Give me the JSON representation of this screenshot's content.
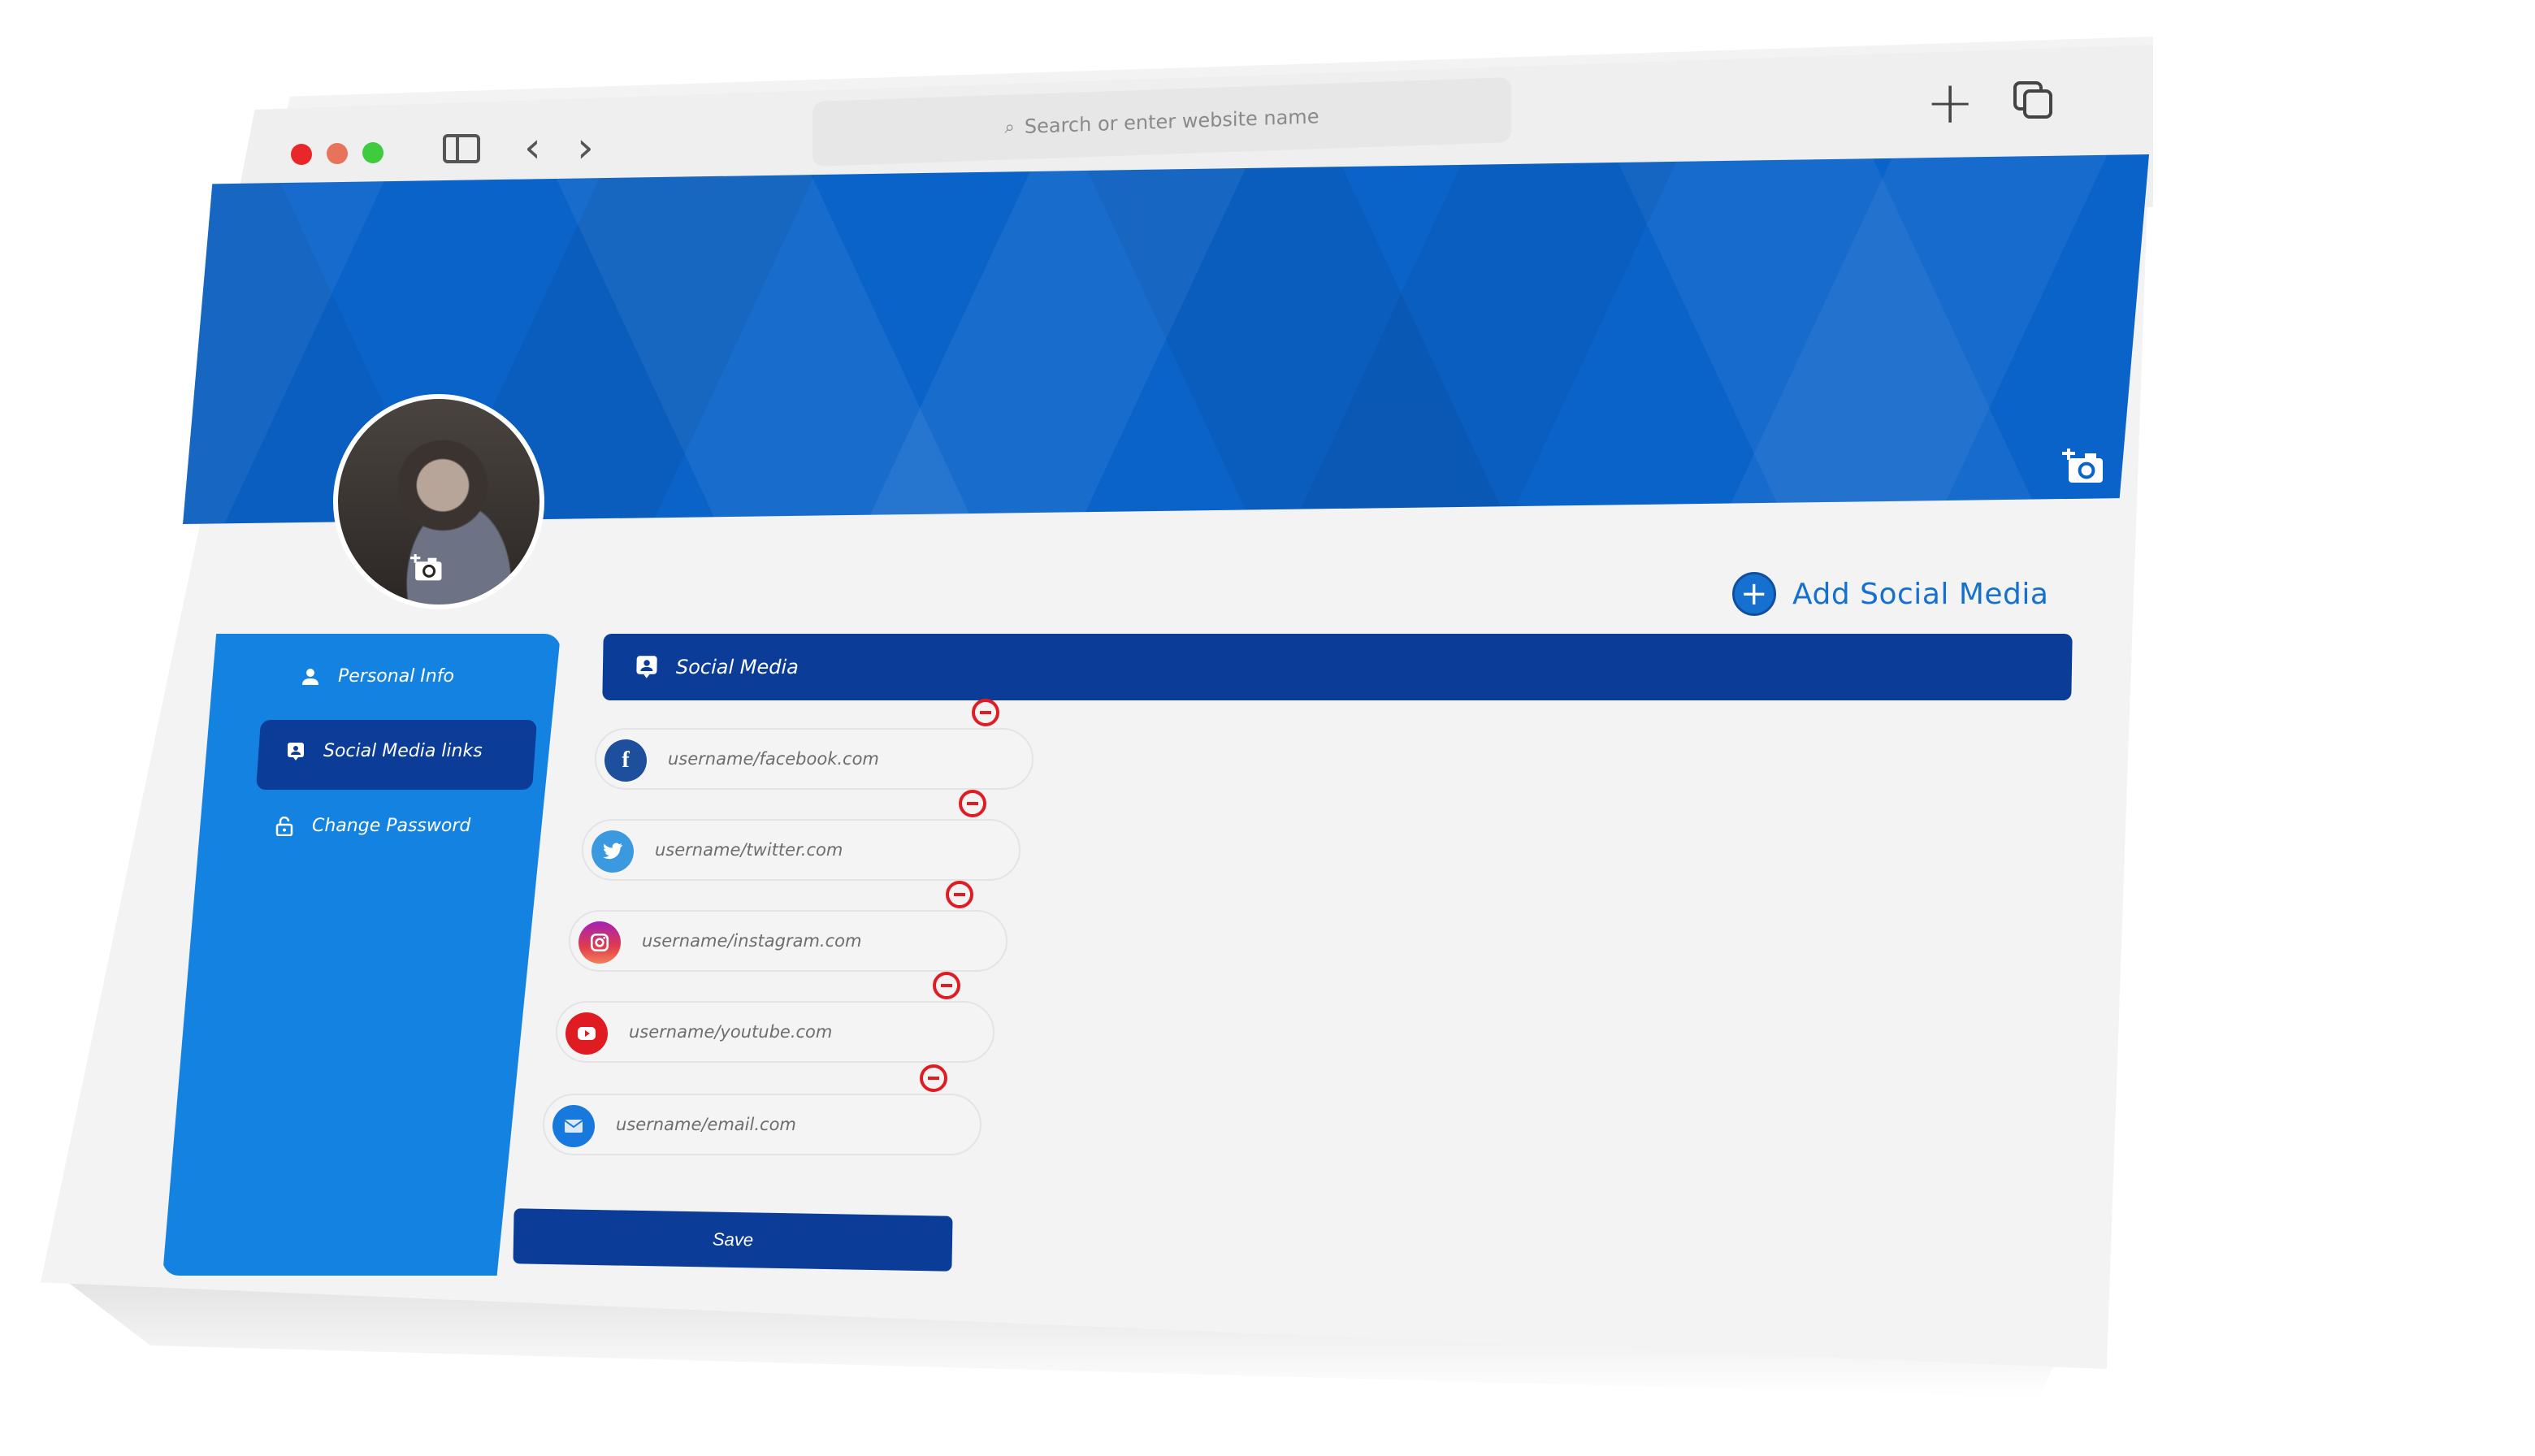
{
  "browser": {
    "address_placeholder": "Search or enter website name",
    "traffic_lights": [
      "close",
      "minimize",
      "maximize"
    ],
    "icons": {
      "sidebar": "sidebar-icon",
      "back": "‹",
      "forward": "›",
      "new_tab": "+",
      "tabs": "tabs-icon"
    }
  },
  "profile": {
    "banner_color": "#0a63c9",
    "banner_camera_icon": "add-photo-icon",
    "avatar_camera_icon": "add-photo-icon"
  },
  "sidebar": {
    "items": [
      {
        "label": "Personal Info",
        "icon": "user-icon",
        "active": false
      },
      {
        "label": "Social Media links",
        "icon": "contact-badge-icon",
        "active": true
      },
      {
        "label": "Change Password",
        "icon": "unlock-icon",
        "active": false
      }
    ]
  },
  "main": {
    "add_button_label": "Add Social Media",
    "section_title": "Social Media",
    "social_links": [
      {
        "platform": "facebook",
        "placeholder": "username/facebook.com",
        "color": "#1d4f9c",
        "glyph": "f"
      },
      {
        "platform": "twitter",
        "placeholder": "username/twitter.com",
        "color": "#3b99e0",
        "glyph": "🐦"
      },
      {
        "platform": "instagram",
        "placeholder": "username/instagram.com",
        "color": "#c2309a",
        "glyph": "◎"
      },
      {
        "platform": "youtube",
        "placeholder": "username/youtube.com",
        "color": "#e11b22",
        "glyph": "▶"
      },
      {
        "platform": "email",
        "placeholder": "username/email.com",
        "color": "#1779de",
        "glyph": "✉"
      }
    ],
    "save_label": "Save"
  },
  "colors": {
    "primary": "#1482e0",
    "primary_dark": "#0b3c97",
    "danger": "#e01c23",
    "accent_text": "#1670d0"
  }
}
